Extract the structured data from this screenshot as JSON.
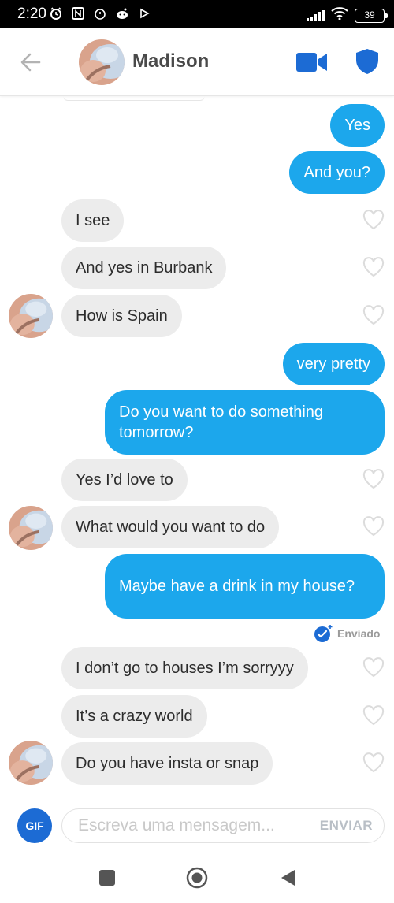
{
  "status_bar": {
    "time": "2:20",
    "battery": "39",
    "left_icons": [
      "alarm-icon",
      "nfc-icon",
      "alarm-clock-icon",
      "reddit-icon",
      "play-icon"
    ],
    "right_icons": [
      "signal-icon",
      "wifi-icon",
      "battery-icon"
    ]
  },
  "header": {
    "name": "Madison",
    "accent": "#1c6bd4"
  },
  "messages": [
    {
      "side": "sent",
      "text": "Yes"
    },
    {
      "side": "sent",
      "text": "And you?"
    },
    {
      "side": "recv",
      "text": "I see"
    },
    {
      "side": "recv",
      "text": "And yes in Burbank"
    },
    {
      "side": "recv",
      "text": "How is Spain"
    },
    {
      "side": "sent",
      "text": "very pretty"
    },
    {
      "side": "sent",
      "text": "Do you want to do something tomorrow?"
    },
    {
      "side": "recv",
      "text": "Yes I’d love to"
    },
    {
      "side": "recv",
      "text": "What would you want to do"
    },
    {
      "side": "sent",
      "text": "Maybe have a drink in my house?"
    },
    {
      "side": "recv",
      "text": "I don’t go to houses I’m sorryyy"
    },
    {
      "side": "recv",
      "text": "It’s a crazy world"
    },
    {
      "side": "recv",
      "text": "Do you have insta or snap"
    }
  ],
  "delivery_status": "Enviado",
  "composer": {
    "gif_label": "GIF",
    "placeholder": "Escreva uma mensagem...",
    "send_label": "ENVIAR"
  },
  "colors": {
    "sent_bubble": "#1ca7ec",
    "received_bubble": "#ececec",
    "gif_button": "#1c6bd4"
  }
}
